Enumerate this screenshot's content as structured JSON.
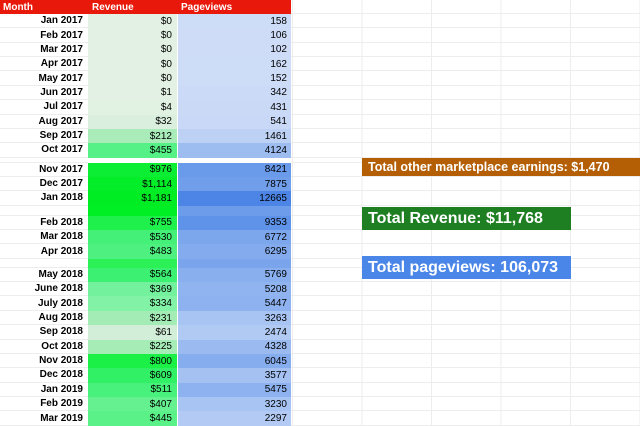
{
  "header": {
    "month": "Month",
    "revenue": "Revenue",
    "pageviews": "Pageviews"
  },
  "colors": {
    "header_bg": "#e8190b",
    "grid_line": "#ededed",
    "revenue_scale_max": "#00ed23",
    "revenue_scale_min": "#e2f1e3",
    "pageviews_scale_max": "#4d85e7",
    "pageviews_scale_min": "#cedcf7"
  },
  "rows": [
    {
      "month": "Jan 2017",
      "revenue": "$0",
      "pageviews": "158",
      "revenue_color": "#e2f1e3",
      "pageviews_color": "#cddcf7"
    },
    {
      "month": "Feb 2017",
      "revenue": "$0",
      "pageviews": "106",
      "revenue_color": "#e2f1e3",
      "pageviews_color": "#cedcf7"
    },
    {
      "month": "Mar 2017",
      "revenue": "$0",
      "pageviews": "102",
      "revenue_color": "#e2f1e3",
      "pageviews_color": "#cedcf7"
    },
    {
      "month": "Apr 2017",
      "revenue": "$0",
      "pageviews": "162",
      "revenue_color": "#e2f1e3",
      "pageviews_color": "#cddcf7"
    },
    {
      "month": "May 2017",
      "revenue": "$0",
      "pageviews": "152",
      "revenue_color": "#e2f1e3",
      "pageviews_color": "#cddcf7"
    },
    {
      "month": "Jun 2017",
      "revenue": "$1",
      "pageviews": "342",
      "revenue_color": "#e2f1e3",
      "pageviews_color": "#cbdaf6"
    },
    {
      "month": "Jul 2017",
      "revenue": "$4",
      "pageviews": "431",
      "revenue_color": "#e1f1e2",
      "pageviews_color": "#c9d9f6"
    },
    {
      "month": "Aug 2017",
      "revenue": "$32",
      "pageviews": "541",
      "revenue_color": "#daefdd",
      "pageviews_color": "#c8d8f6"
    },
    {
      "month": "Sep 2017",
      "revenue": "$212",
      "pageviews": "1461",
      "revenue_color": "#a9ecba",
      "pageviews_color": "#bdd1f4"
    },
    {
      "month": "Oct 2017",
      "revenue": "$455",
      "pageviews": "4124",
      "revenue_color": "#55f186",
      "pageviews_color": "#9dbdf1"
    },
    {
      "spacer": true,
      "height": 5,
      "revenue_color": "#ffffff",
      "pageviews_color": "#ffffff"
    },
    {
      "month": "Nov 2017",
      "revenue": "$976",
      "pageviews": "8421",
      "revenue_color": "#0cee33",
      "pageviews_color": "#6a9aea"
    },
    {
      "month": "Dec 2017",
      "revenue": "$1,114",
      "pageviews": "7875",
      "revenue_color": "#03ee29",
      "pageviews_color": "#709eeb"
    },
    {
      "month": "Jan 2018",
      "revenue": "$1,181",
      "pageviews": "12665",
      "revenue_color": "#00ed23",
      "pageviews_color": "#4d85e7"
    },
    {
      "spacer": true,
      "height": 10,
      "revenue_color": "#00ee24",
      "pageviews_color": "#6d9ceb"
    },
    {
      "month": "Feb 2018",
      "revenue": "$755",
      "pageviews": "9353",
      "revenue_color": "#1ff04b",
      "pageviews_color": "#5f93e9"
    },
    {
      "month": "Mar 2018",
      "revenue": "$530",
      "pageviews": "6772",
      "revenue_color": "#44f077",
      "pageviews_color": "#7da7ed"
    },
    {
      "month": "Apr 2018",
      "revenue": "$483",
      "pageviews": "6295",
      "revenue_color": "#4ef180",
      "pageviews_color": "#83abed"
    },
    {
      "spacer": true,
      "height": 9,
      "revenue_color": "#2bf157",
      "pageviews_color": "#7aa5ec"
    },
    {
      "month": "May 2018",
      "revenue": "$564",
      "pageviews": "5769",
      "revenue_color": "#3cf071",
      "pageviews_color": "#89afee"
    },
    {
      "month": "June 2018",
      "revenue": "$369",
      "pageviews": "5208",
      "revenue_color": "#74f19d",
      "pageviews_color": "#90b4ef"
    },
    {
      "month": "July 2018",
      "revenue": "$334",
      "pageviews": "5447",
      "revenue_color": "#81f2a6",
      "pageviews_color": "#8db2ef"
    },
    {
      "month": "Aug 2018",
      "revenue": "$231",
      "pageviews": "3263",
      "revenue_color": "#a3ecb6",
      "pageviews_color": "#a8c4f2"
    },
    {
      "month": "Sep 2018",
      "revenue": "$61",
      "pageviews": "2474",
      "revenue_color": "#d3eed8",
      "pageviews_color": "#b1caf3"
    },
    {
      "month": "Oct 2018",
      "revenue": "$225",
      "pageviews": "4328",
      "revenue_color": "#a5ecb7",
      "pageviews_color": "#9bbbf0"
    },
    {
      "month": "Nov 2018",
      "revenue": "$800",
      "pageviews": "6045",
      "revenue_color": "#1af046",
      "pageviews_color": "#86adee"
    },
    {
      "month": "Dec 2018",
      "revenue": "$609",
      "pageviews": "3577",
      "revenue_color": "#32f066",
      "pageviews_color": "#a4c1f2"
    },
    {
      "month": "Jan 2019",
      "revenue": "$511",
      "pageviews": "5475",
      "revenue_color": "#48f17b",
      "pageviews_color": "#8db2ef"
    },
    {
      "month": "Feb 2019",
      "revenue": "$407",
      "pageviews": "3230",
      "revenue_color": "#66f191",
      "pageviews_color": "#a8c4f2"
    },
    {
      "month": "Mar 2019",
      "revenue": "$445",
      "pageviews": "2297",
      "revenue_color": "#59f188",
      "pageviews_color": "#b3cbf4"
    }
  ],
  "callouts": [
    {
      "label": "Total other marketplace earnings: $1,470",
      "bg": "#b45f06"
    },
    {
      "label": "Total Revenue: $11,768",
      "bg": "#1e7e22"
    },
    {
      "label": "Total pageviews: 106,073",
      "bg": "#4a86e8"
    }
  ]
}
